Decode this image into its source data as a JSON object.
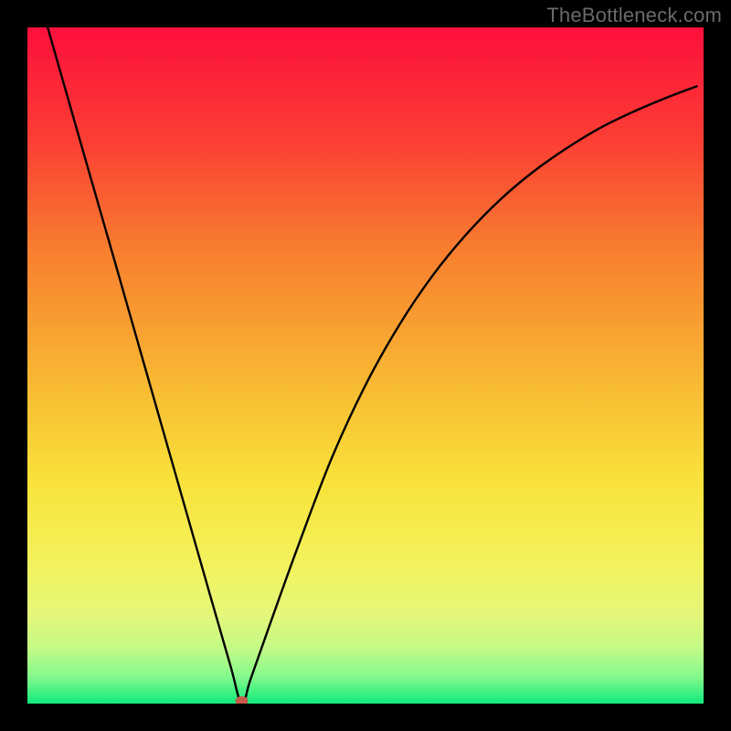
{
  "watermark": "TheBottleneck.com",
  "chart_data": {
    "type": "line",
    "title": "",
    "xlabel": "",
    "ylabel": "",
    "xlim": [
      0,
      100
    ],
    "ylim": [
      0,
      100
    ],
    "grid": false,
    "legend": false,
    "series": [
      {
        "name": "curve",
        "x": [
          3,
          5,
          8,
          12,
          15,
          18,
          21,
          24,
          27,
          30,
          31.7,
          33,
          36,
          40,
          45,
          50,
          55,
          60,
          65,
          70,
          75,
          80,
          85,
          90,
          95,
          99
        ],
        "y": [
          100,
          93,
          82.5,
          68.6,
          58.1,
          47.6,
          37.1,
          26.6,
          16.1,
          5.7,
          0,
          3.6,
          12.1,
          23.2,
          36.3,
          47.1,
          56,
          63.4,
          69.5,
          74.6,
          78.8,
          82.3,
          85.3,
          87.7,
          89.8,
          91.3
        ]
      }
    ],
    "marker": {
      "x": 31.7,
      "y": 0,
      "color": "#c85a4a"
    },
    "background_gradient": {
      "stops": [
        {
          "offset": 0.0,
          "color": "#fd0f3c"
        },
        {
          "offset": 0.17,
          "color": "#fb3f34"
        },
        {
          "offset": 0.33,
          "color": "#f87e2f"
        },
        {
          "offset": 0.5,
          "color": "#f8b132"
        },
        {
          "offset": 0.67,
          "color": "#f9e23a"
        },
        {
          "offset": 0.8,
          "color": "#f2f35f"
        },
        {
          "offset": 0.87,
          "color": "#e4f77a"
        },
        {
          "offset": 0.92,
          "color": "#c1fa86"
        },
        {
          "offset": 0.96,
          "color": "#85f98c"
        },
        {
          "offset": 1.0,
          "color": "#10ea7c"
        }
      ]
    }
  }
}
